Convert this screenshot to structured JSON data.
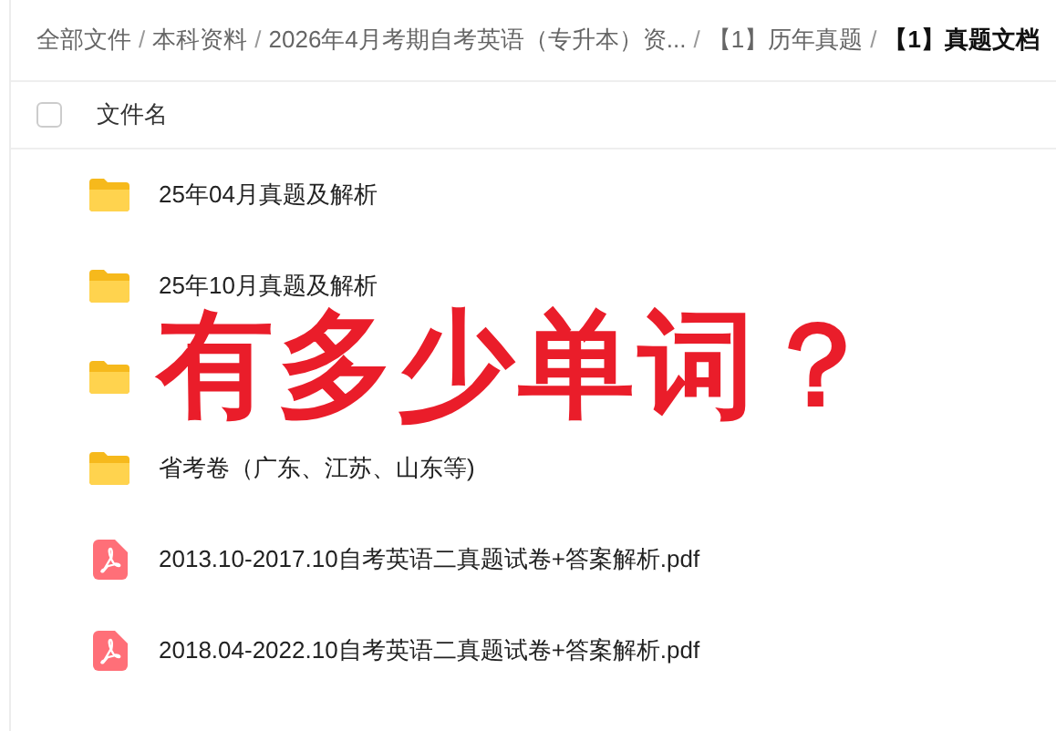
{
  "breadcrumb": {
    "separator": "/",
    "items": [
      {
        "label": "全部文件",
        "current": false
      },
      {
        "label": "本科资料",
        "current": false
      },
      {
        "label": "2026年4月考期自考英语（专升本）资...",
        "current": false
      },
      {
        "label": "【1】历年真题",
        "current": false
      },
      {
        "label": "【1】真题文档",
        "current": true
      }
    ]
  },
  "table": {
    "select_all": {
      "checked": false
    },
    "columns": [
      "文件名"
    ],
    "rows": [
      {
        "kind": "folder",
        "name": "25年04月真题及解析"
      },
      {
        "kind": "folder",
        "name": "25年10月真题及解析"
      },
      {
        "kind": "folder"
      },
      {
        "kind": "folder",
        "name": "省考卷（广东、江苏、山东等)"
      },
      {
        "kind": "pdf",
        "name": "2013.10-2017.10自考英语二真题试卷+答案解析.pdf"
      },
      {
        "kind": "pdf",
        "name": "2018.04-2022.10自考英语二真题试卷+答案解析.pdf"
      }
    ]
  },
  "overlay_caption": "有多少单词？"
}
